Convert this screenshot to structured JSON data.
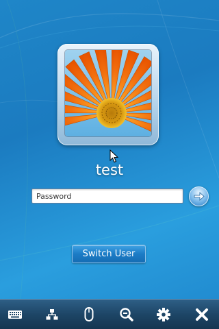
{
  "login": {
    "username": "test",
    "password_placeholder": "Password",
    "password_value": "",
    "switch_user_label": "Switch User"
  },
  "toolbar": {
    "items": [
      {
        "icon": "keyboard-icon"
      },
      {
        "icon": "network-icon"
      },
      {
        "icon": "mouse-icon"
      },
      {
        "icon": "zoom-out-icon"
      },
      {
        "icon": "gear-icon"
      },
      {
        "icon": "close-icon"
      }
    ]
  },
  "colors": {
    "background": "#1f86c8",
    "toolbar": "#1d4566",
    "button": "#1c7cc6",
    "flower": "#f26a10"
  }
}
